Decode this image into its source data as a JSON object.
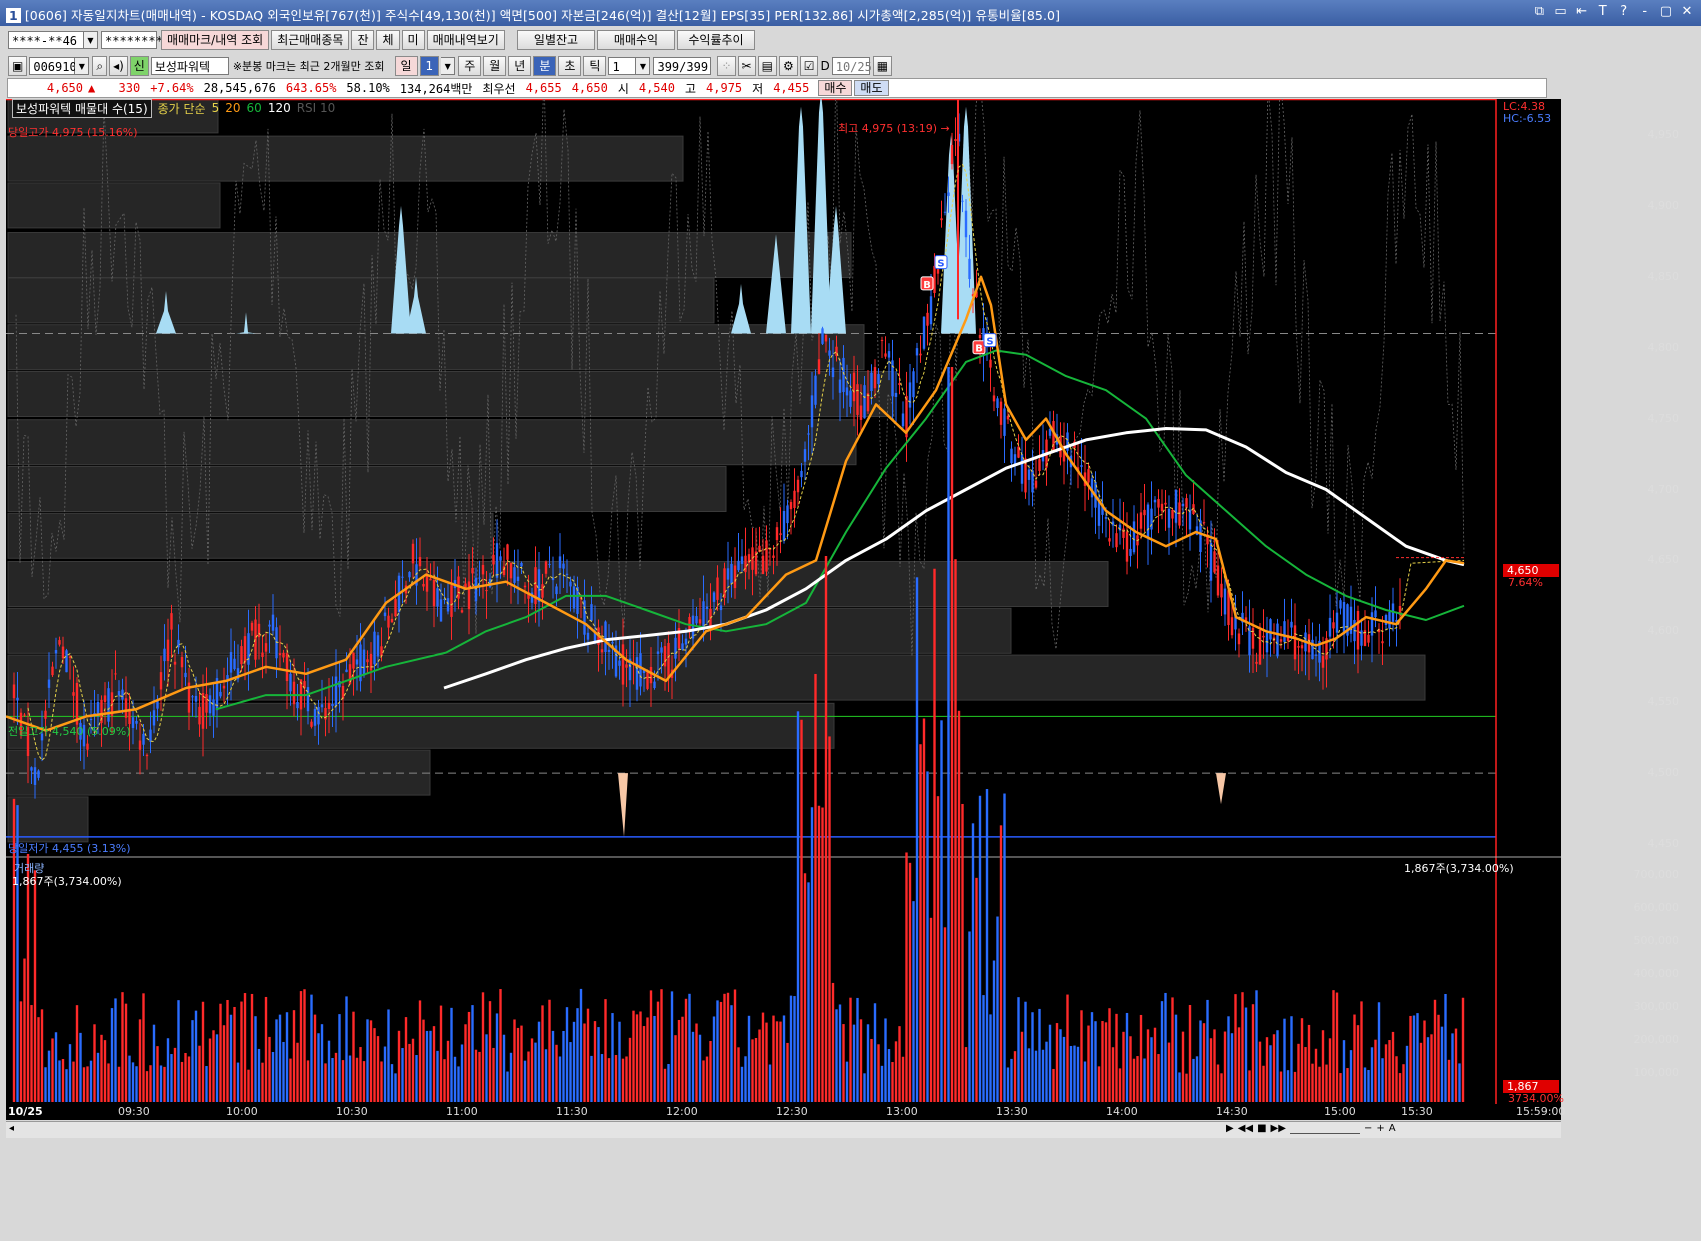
{
  "window": {
    "title_prefix": "1",
    "title": "[0606] 자동일지차트(매매내역) - KOSDAQ 외국인보유[767(천)] 주식수[49,130(천)] 액면[500] 자본금[246(억)] 결산[12월] EPS[35] PER[132.86] 시가총액[2,285(억)] 유통비율[85.0]",
    "controls": [
      "⧉",
      "▭",
      "⇤",
      "T",
      "?",
      "-",
      "▢",
      "✕"
    ]
  },
  "toolbar1": {
    "account": "****-**46",
    "password": "********",
    "buttons": [
      "매매마크/내역 조회",
      "최근매매종목",
      "잔",
      "체",
      "미",
      "매매내역보기"
    ],
    "buttons_right": [
      "일별잔고",
      "매매수익",
      "수익률추이"
    ]
  },
  "toolbar2": {
    "code": "006910",
    "sin": "신",
    "name": "보성파워텍",
    "note": "※분봉 마크는 최근 2개월만 조회",
    "periods": [
      "일",
      "1",
      "주",
      "월",
      "년",
      "분",
      "초",
      "틱"
    ],
    "interval": "1",
    "count": "399/399",
    "d_label": "D",
    "date": "10/25"
  },
  "quote": {
    "price": "4,650",
    "arrow": "▲",
    "change": "330",
    "change_pct": "+7.64%",
    "volume": "28,545,676",
    "vol_ratio": "643.65%",
    "turnover": "58.10%",
    "amount": "134,264백만",
    "best_label": "최우선",
    "ask": "4,655",
    "bid": "4,650",
    "open_label": "시",
    "open": "4,540",
    "high_label": "고",
    "high": "4,975",
    "low_label": "저",
    "low": "4,455",
    "buy": "매수",
    "sell": "매도"
  },
  "legend": {
    "title": "보성파워텍 매물대 수(15)",
    "ma_label": "종가 단순",
    "ma5": "5",
    "ma20": "20",
    "ma60": "60",
    "ma120": "120",
    "rsi": "RSI 10"
  },
  "annotations": {
    "day_high": "당일고가 4,975 (15.16%)",
    "top_mark": "최고 4,975 (13:19) →",
    "prev_high": "전일고가 4,540 (5.09%)",
    "day_low": "당일저가 4,455 (3.13%)",
    "lc": "LC:4.38",
    "hc": "HC:-6.53",
    "last_price": "4,650",
    "last_pct": "7.64%"
  },
  "volume_panel": {
    "title": "거래량",
    "subtitle": "1,867주(3,734.00%)",
    "right_label": "1,867주(3,734.00%)",
    "last": "1,867",
    "last_pct": "3734.00%"
  },
  "colors": {
    "up": "#ff2a2a",
    "down": "#2a6cff",
    "ma5": "#e6d24a",
    "ma20": "#ff9a14",
    "ma60": "#16b53a",
    "ma120": "#ffffff",
    "profile": "#262626"
  },
  "chart_data": {
    "type": "candlestick",
    "price_axis": [
      4450,
      4500,
      4550,
      4600,
      4650,
      4700,
      4750,
      4800,
      4850,
      4900,
      4950
    ],
    "price_axis_labels": [
      "4,450",
      "4,500",
      "4,550",
      "4,600",
      "4,650",
      "4,700",
      "4,750",
      "4,800",
      "4,850",
      "4,900",
      "4,950"
    ],
    "volume_axis_labels": [
      "100,000",
      "200,000",
      "300,000",
      "400,000",
      "500,000",
      "600,000",
      "700,000"
    ],
    "time_labels": [
      "10/25",
      "09:30",
      "10:00",
      "10:30",
      "11:00",
      "11:30",
      "12:00",
      "12:30",
      "13:00",
      "13:30",
      "14:00",
      "14:30",
      "15:00",
      "15:30",
      "15:59:00"
    ],
    "ma20_path": [
      [
        0,
        4540
      ],
      [
        40,
        4530
      ],
      [
        80,
        4540
      ],
      [
        130,
        4545
      ],
      [
        180,
        4560
      ],
      [
        220,
        4565
      ],
      [
        260,
        4575
      ],
      [
        300,
        4570
      ],
      [
        340,
        4580
      ],
      [
        380,
        4620
      ],
      [
        420,
        4640
      ],
      [
        460,
        4630
      ],
      [
        500,
        4635
      ],
      [
        540,
        4620
      ],
      [
        580,
        4605
      ],
      [
        620,
        4580
      ],
      [
        660,
        4565
      ],
      [
        700,
        4600
      ],
      [
        740,
        4610
      ],
      [
        780,
        4640
      ],
      [
        810,
        4650
      ],
      [
        840,
        4720
      ],
      [
        870,
        4760
      ],
      [
        900,
        4740
      ],
      [
        930,
        4770
      ],
      [
        960,
        4820
      ],
      [
        975,
        4850
      ],
      [
        985,
        4830
      ],
      [
        1000,
        4760
      ],
      [
        1020,
        4735
      ],
      [
        1040,
        4750
      ],
      [
        1060,
        4725
      ],
      [
        1080,
        4705
      ],
      [
        1100,
        4685
      ],
      [
        1130,
        4670
      ],
      [
        1160,
        4660
      ],
      [
        1190,
        4670
      ],
      [
        1210,
        4665
      ],
      [
        1230,
        4610
      ],
      [
        1260,
        4600
      ],
      [
        1290,
        4595
      ],
      [
        1310,
        4590
      ],
      [
        1330,
        4595
      ],
      [
        1360,
        4610
      ],
      [
        1390,
        4605
      ],
      [
        1420,
        4630
      ],
      [
        1440,
        4650
      ],
      [
        1458,
        4648
      ]
    ],
    "ma60_path": [
      [
        210,
        4545
      ],
      [
        260,
        4555
      ],
      [
        300,
        4555
      ],
      [
        340,
        4565
      ],
      [
        380,
        4575
      ],
      [
        440,
        4585
      ],
      [
        480,
        4600
      ],
      [
        520,
        4610
      ],
      [
        560,
        4625
      ],
      [
        600,
        4625
      ],
      [
        640,
        4615
      ],
      [
        680,
        4605
      ],
      [
        720,
        4600
      ],
      [
        760,
        4605
      ],
      [
        800,
        4620
      ],
      [
        840,
        4670
      ],
      [
        880,
        4715
      ],
      [
        920,
        4750
      ],
      [
        960,
        4790
      ],
      [
        990,
        4798
      ],
      [
        1020,
        4795
      ],
      [
        1060,
        4780
      ],
      [
        1100,
        4770
      ],
      [
        1140,
        4750
      ],
      [
        1180,
        4710
      ],
      [
        1220,
        4685
      ],
      [
        1260,
        4660
      ],
      [
        1300,
        4640
      ],
      [
        1340,
        4625
      ],
      [
        1380,
        4615
      ],
      [
        1420,
        4608
      ],
      [
        1458,
        4618
      ]
    ],
    "ma120_path": [
      [
        438,
        4560
      ],
      [
        480,
        4570
      ],
      [
        520,
        4580
      ],
      [
        560,
        4588
      ],
      [
        600,
        4594
      ],
      [
        640,
        4597
      ],
      [
        680,
        4600
      ],
      [
        720,
        4605
      ],
      [
        760,
        4615
      ],
      [
        800,
        4630
      ],
      [
        840,
        4650
      ],
      [
        880,
        4665
      ],
      [
        920,
        4685
      ],
      [
        960,
        4700
      ],
      [
        1000,
        4715
      ],
      [
        1040,
        4725
      ],
      [
        1080,
        4735
      ],
      [
        1120,
        4740
      ],
      [
        1160,
        4743
      ],
      [
        1200,
        4742
      ],
      [
        1240,
        4730
      ],
      [
        1280,
        4712
      ],
      [
        1320,
        4700
      ],
      [
        1360,
        4680
      ],
      [
        1400,
        4660
      ],
      [
        1440,
        4650
      ],
      [
        1458,
        4647
      ]
    ],
    "profile_bars": [
      {
        "price": 4967,
        "len": 210
      },
      {
        "price": 4933,
        "len": 675
      },
      {
        "price": 4900,
        "len": 212
      },
      {
        "price": 4865,
        "len": 843
      },
      {
        "price": 4833,
        "len": 706
      },
      {
        "price": 4800,
        "len": 856
      },
      {
        "price": 4767,
        "len": 886
      },
      {
        "price": 4733,
        "len": 848
      },
      {
        "price": 4700,
        "len": 718
      },
      {
        "price": 4667,
        "len": 485
      },
      {
        "price": 4633,
        "len": 1100
      },
      {
        "price": 4600,
        "len": 1003
      },
      {
        "price": 4567,
        "len": 1417
      },
      {
        "price": 4533,
        "len": 826
      },
      {
        "price": 4500,
        "len": 422
      },
      {
        "price": 4467,
        "len": 80
      }
    ],
    "markers": [
      {
        "type": "S",
        "t": 935,
        "p": 4860
      },
      {
        "type": "B",
        "t": 921,
        "p": 4845
      },
      {
        "type": "B",
        "t": 973,
        "p": 4800
      },
      {
        "type": "S",
        "t": 984,
        "p": 4805
      }
    ]
  }
}
